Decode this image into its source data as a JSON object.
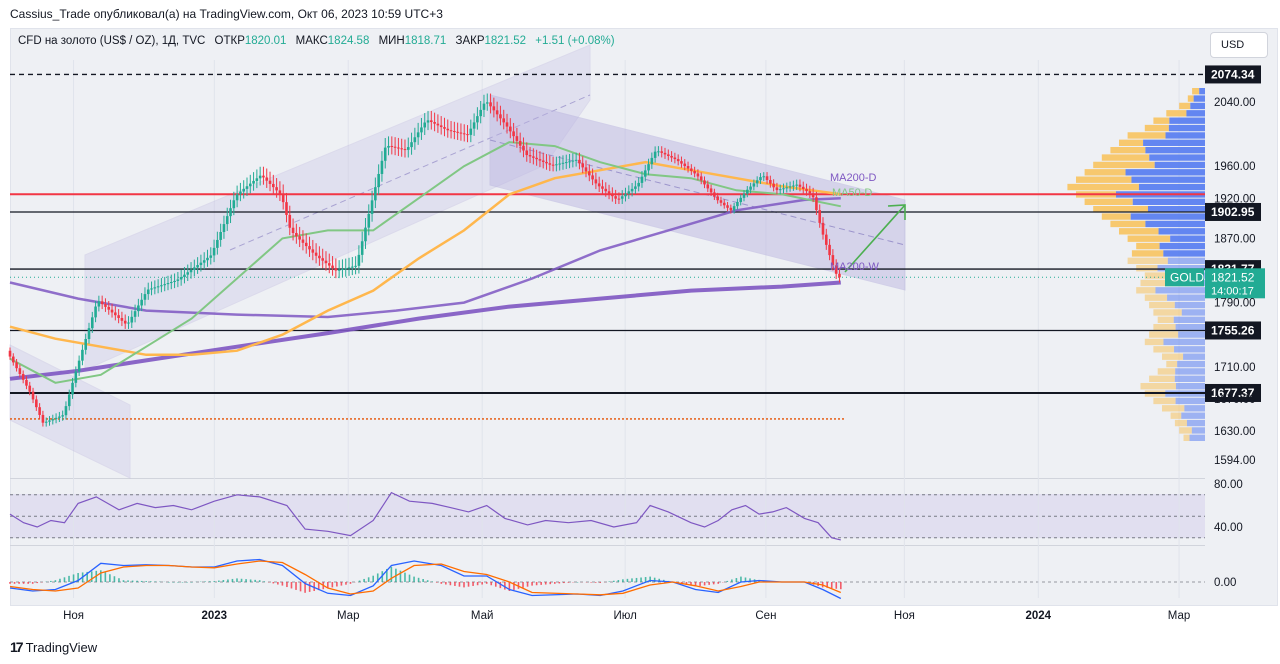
{
  "header": {
    "published": "Cassius_Trade опубликовал(а) на TradingView.com, Окт 06, 2023 10:59 UTC+3",
    "symbol": "CFD на золото (US$ / OZ), 1Д, TVC",
    "open_label": "ОТКР",
    "open": "1820.01",
    "high_label": "МАКС",
    "high": "1824.58",
    "low_label": "МИН",
    "low": "1818.71",
    "close_label": "ЗАКР",
    "close": "1821.52",
    "change": "+1.51 (+0.08%)"
  },
  "currency_button": "USD",
  "footer": {
    "logo_text": "TradingView",
    "logo_mark": "17"
  },
  "colors": {
    "up": "#22ab94",
    "down": "#f23645",
    "ma50": "#81c784",
    "ma200d": "#ffb74d",
    "ma200w": "#7e57c2",
    "red_level": "#f23645",
    "rsi": "#7e57c2",
    "macd": "#2962ff",
    "signal": "#ff6d00",
    "profile_up": "#5b7ff0",
    "profile_down": "#f7c35f"
  },
  "chart_data": {
    "type": "candlestick",
    "title": "CFD на золото (US$ / OZ), 1Д, TVC",
    "ylim": [
      1594,
      2074.34
    ],
    "y_ticks": [
      "2040.00",
      "1960.00",
      "1920.00",
      "1870.00",
      "1790.00",
      "1710.00",
      "1670.00",
      "1630.00",
      "1594.00"
    ],
    "x_ticks": [
      {
        "label": "Ноя",
        "day": 28
      },
      {
        "label": "2023",
        "day": 90
      },
      {
        "label": "Мар",
        "day": 149
      },
      {
        "label": "Май",
        "day": 208
      },
      {
        "label": "Июл",
        "day": 271
      },
      {
        "label": "Сен",
        "day": 333
      },
      {
        "label": "Ноя",
        "day": 394
      },
      {
        "label": "2024",
        "day": 453
      },
      {
        "label": "Мар",
        "day": 515
      }
    ],
    "price_path": [
      [
        0,
        1730
      ],
      [
        10,
        1680
      ],
      [
        16,
        1640
      ],
      [
        25,
        1650
      ],
      [
        30,
        1700
      ],
      [
        40,
        1793
      ],
      [
        53,
        1762
      ],
      [
        62,
        1806
      ],
      [
        75,
        1818
      ],
      [
        90,
        1849
      ],
      [
        101,
        1924
      ],
      [
        112,
        1949
      ],
      [
        121,
        1924
      ],
      [
        125,
        1880
      ],
      [
        136,
        1849
      ],
      [
        145,
        1830
      ],
      [
        154,
        1836
      ],
      [
        161,
        1918
      ],
      [
        167,
        1986
      ],
      [
        176,
        1980
      ],
      [
        185,
        2018
      ],
      [
        194,
        2005
      ],
      [
        203,
        1999
      ],
      [
        211,
        2042
      ],
      [
        220,
        2011
      ],
      [
        229,
        1974
      ],
      [
        240,
        1961
      ],
      [
        251,
        1968
      ],
      [
        260,
        1937
      ],
      [
        269,
        1918
      ],
      [
        278,
        1937
      ],
      [
        286,
        1980
      ],
      [
        295,
        1968
      ],
      [
        304,
        1949
      ],
      [
        313,
        1918
      ],
      [
        319,
        1905
      ],
      [
        326,
        1930
      ],
      [
        333,
        1949
      ],
      [
        339,
        1930
      ],
      [
        348,
        1937
      ],
      [
        355,
        1924
      ],
      [
        359,
        1880
      ],
      [
        364,
        1836
      ],
      [
        366,
        1821.52
      ]
    ],
    "ma50_path": [
      [
        0,
        1720
      ],
      [
        20,
        1690
      ],
      [
        40,
        1700
      ],
      [
        60,
        1735
      ],
      [
        80,
        1770
      ],
      [
        100,
        1820
      ],
      [
        120,
        1870
      ],
      [
        140,
        1880
      ],
      [
        160,
        1880
      ],
      [
        180,
        1920
      ],
      [
        200,
        1960
      ],
      [
        220,
        1990
      ],
      [
        240,
        1985
      ],
      [
        260,
        1965
      ],
      [
        280,
        1950
      ],
      [
        300,
        1945
      ],
      [
        320,
        1930
      ],
      [
        340,
        1925
      ],
      [
        366,
        1910
      ]
    ],
    "ma200d_path": [
      [
        0,
        1760
      ],
      [
        20,
        1745
      ],
      [
        40,
        1735
      ],
      [
        60,
        1725
      ],
      [
        80,
        1725
      ],
      [
        100,
        1730
      ],
      [
        120,
        1750
      ],
      [
        140,
        1780
      ],
      [
        160,
        1805
      ],
      [
        180,
        1845
      ],
      [
        200,
        1880
      ],
      [
        220,
        1925
      ],
      [
        240,
        1945
      ],
      [
        260,
        1955
      ],
      [
        280,
        1965
      ],
      [
        300,
        1955
      ],
      [
        320,
        1945
      ],
      [
        340,
        1935
      ],
      [
        366,
        1925
      ]
    ],
    "ma200w_path": [
      [
        0,
        1695
      ],
      [
        30,
        1705
      ],
      [
        60,
        1718
      ],
      [
        100,
        1735
      ],
      [
        140,
        1752
      ],
      [
        180,
        1770
      ],
      [
        220,
        1785
      ],
      [
        260,
        1795
      ],
      [
        300,
        1805
      ],
      [
        340,
        1810
      ],
      [
        366,
        1815
      ]
    ],
    "ma200w_upper_path": [
      [
        0,
        1815
      ],
      [
        30,
        1795
      ],
      [
        60,
        1780
      ],
      [
        100,
        1775
      ],
      [
        140,
        1772
      ],
      [
        170,
        1780
      ],
      [
        200,
        1790
      ],
      [
        230,
        1820
      ],
      [
        260,
        1855
      ],
      [
        290,
        1880
      ],
      [
        320,
        1905
      ],
      [
        350,
        1918
      ],
      [
        366,
        1920
      ]
    ],
    "levels": [
      {
        "price": "2074.34",
        "style": "dashed"
      },
      {
        "price": "1925.00",
        "style": "red",
        "label": ""
      },
      {
        "price": "1902.95",
        "style": "solid"
      },
      {
        "price": "1831.77",
        "style": "solid"
      },
      {
        "price": "1755.26",
        "style": "solid"
      },
      {
        "price": "1677.37",
        "style": "solid-bold"
      },
      {
        "price": "1645.00",
        "style": "orange-dotted",
        "label": ""
      }
    ],
    "last_price": {
      "symbol": "GOLD",
      "price": "1821.52",
      "countdown": "14:00:17"
    },
    "ma_labels": {
      "ma200d": "MA200-D",
      "ma50d": "MA50-D",
      "ma200w": "MA200-W"
    },
    "volume_profile": [
      3,
      4,
      6,
      9,
      12,
      14,
      18,
      20,
      22,
      24,
      26,
      28,
      30,
      32,
      30,
      28,
      26,
      24,
      22,
      20,
      18,
      16,
      17,
      18,
      16,
      14,
      15,
      16,
      14,
      13,
      12,
      11,
      12,
      13,
      14,
      12,
      10,
      9,
      11,
      13,
      15,
      14,
      12,
      10,
      8,
      7,
      6,
      5
    ],
    "rsi": {
      "levels": [
        70,
        50,
        30
      ],
      "y_ticks": [
        "80.00",
        "40.00"
      ],
      "values": [
        [
          0,
          52
        ],
        [
          6,
          44
        ],
        [
          12,
          40
        ],
        [
          18,
          46
        ],
        [
          24,
          44
        ],
        [
          30,
          62
        ],
        [
          38,
          68
        ],
        [
          48,
          56
        ],
        [
          56,
          62
        ],
        [
          64,
          58
        ],
        [
          72,
          60
        ],
        [
          80,
          56
        ],
        [
          90,
          64
        ],
        [
          100,
          70
        ],
        [
          110,
          68
        ],
        [
          122,
          60
        ],
        [
          130,
          38
        ],
        [
          140,
          36
        ],
        [
          150,
          32
        ],
        [
          160,
          46
        ],
        [
          168,
          72
        ],
        [
          176,
          64
        ],
        [
          186,
          62
        ],
        [
          194,
          58
        ],
        [
          202,
          54
        ],
        [
          210,
          60
        ],
        [
          218,
          48
        ],
        [
          228,
          42
        ],
        [
          236,
          46
        ],
        [
          246,
          44
        ],
        [
          256,
          46
        ],
        [
          266,
          40
        ],
        [
          276,
          44
        ],
        [
          282,
          60
        ],
        [
          290,
          54
        ],
        [
          300,
          44
        ],
        [
          306,
          40
        ],
        [
          312,
          46
        ],
        [
          318,
          56
        ],
        [
          324,
          60
        ],
        [
          330,
          52
        ],
        [
          336,
          54
        ],
        [
          342,
          58
        ],
        [
          350,
          48
        ],
        [
          356,
          44
        ],
        [
          362,
          30
        ],
        [
          366,
          28
        ]
      ]
    },
    "macd": {
      "y_ticks": [
        "0.00"
      ],
      "macd": [
        [
          0,
          -8
        ],
        [
          10,
          -12
        ],
        [
          20,
          -10
        ],
        [
          30,
          2
        ],
        [
          40,
          25
        ],
        [
          50,
          22
        ],
        [
          60,
          23
        ],
        [
          70,
          22
        ],
        [
          80,
          20
        ],
        [
          90,
          20
        ],
        [
          100,
          28
        ],
        [
          110,
          30
        ],
        [
          120,
          22
        ],
        [
          130,
          -2
        ],
        [
          140,
          -15
        ],
        [
          150,
          -18
        ],
        [
          160,
          -5
        ],
        [
          168,
          22
        ],
        [
          178,
          28
        ],
        [
          190,
          22
        ],
        [
          200,
          8
        ],
        [
          210,
          8
        ],
        [
          220,
          -10
        ],
        [
          230,
          -18
        ],
        [
          250,
          -16
        ],
        [
          260,
          -18
        ],
        [
          270,
          -12
        ],
        [
          282,
          2
        ],
        [
          292,
          0
        ],
        [
          302,
          -10
        ],
        [
          312,
          -14
        ],
        [
          322,
          0
        ],
        [
          330,
          2
        ],
        [
          340,
          0
        ],
        [
          350,
          0
        ],
        [
          358,
          -10
        ],
        [
          366,
          -22
        ]
      ],
      "signal": [
        [
          0,
          -6
        ],
        [
          10,
          -10
        ],
        [
          20,
          -12
        ],
        [
          30,
          -8
        ],
        [
          40,
          12
        ],
        [
          50,
          20
        ],
        [
          60,
          22
        ],
        [
          70,
          22
        ],
        [
          80,
          20
        ],
        [
          90,
          19
        ],
        [
          100,
          24
        ],
        [
          110,
          28
        ],
        [
          120,
          26
        ],
        [
          130,
          10
        ],
        [
          140,
          -8
        ],
        [
          150,
          -16
        ],
        [
          160,
          -12
        ],
        [
          168,
          5
        ],
        [
          178,
          22
        ],
        [
          190,
          24
        ],
        [
          200,
          14
        ],
        [
          210,
          10
        ],
        [
          220,
          0
        ],
        [
          230,
          -14
        ],
        [
          250,
          -16
        ],
        [
          260,
          -17
        ],
        [
          270,
          -15
        ],
        [
          282,
          -4
        ],
        [
          292,
          0
        ],
        [
          302,
          -5
        ],
        [
          312,
          -12
        ],
        [
          322,
          -6
        ],
        [
          330,
          0
        ],
        [
          340,
          0
        ],
        [
          350,
          0
        ],
        [
          358,
          -4
        ],
        [
          366,
          -14
        ]
      ]
    }
  }
}
